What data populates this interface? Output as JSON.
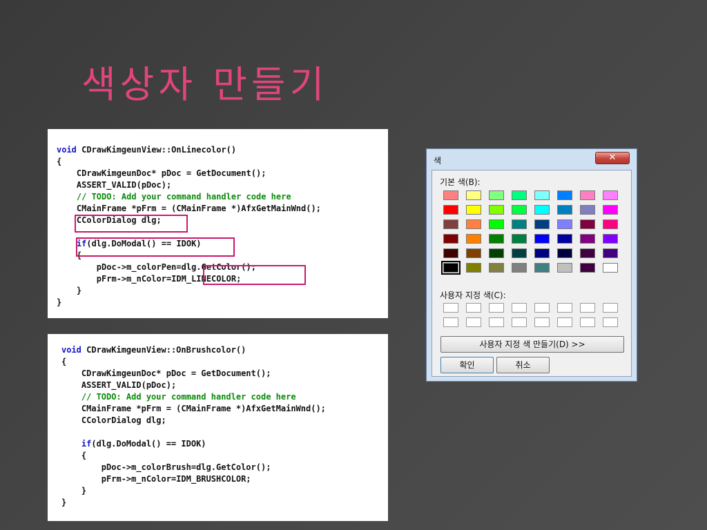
{
  "slide": {
    "title": "색상자 만들기"
  },
  "code_blocks": [
    {
      "lines": [
        [
          {
            "t": "void",
            "c": "kw"
          },
          {
            "t": " CDrawKimgeunView::OnLinecolor()"
          }
        ],
        [
          {
            "t": "{"
          }
        ],
        [
          {
            "t": "    CDrawKimgeunDoc* pDoc = GetDocument();"
          }
        ],
        [
          {
            "t": "    ASSERT_VALID(pDoc);"
          }
        ],
        [
          {
            "t": "    // TODO: Add your command handler code here",
            "c": "cm"
          }
        ],
        [
          {
            "t": "    CMainFrame *pFrm = (CMainFrame *)AfxGetMainWnd();"
          }
        ],
        [
          {
            "t": "    CColorDialog dlg;"
          }
        ],
        [
          {
            "t": ""
          }
        ],
        [
          {
            "t": "    "
          },
          {
            "t": "if",
            "c": "kw"
          },
          {
            "t": "(dlg.DoModal() == IDOK)"
          }
        ],
        [
          {
            "t": "    {"
          }
        ],
        [
          {
            "t": "        pDoc->m_colorPen=dlg.GetColor();"
          }
        ],
        [
          {
            "t": "        pFrm->m_nColor=IDM_LINECOLOR;"
          }
        ],
        [
          {
            "t": "    }"
          }
        ],
        [
          {
            "t": "}"
          }
        ]
      ]
    },
    {
      "lines": [
        [
          {
            "t": "void",
            "c": "kw"
          },
          {
            "t": " CDrawKimgeunView::OnBrushcolor()"
          }
        ],
        [
          {
            "t": "{"
          }
        ],
        [
          {
            "t": "    CDrawKimgeunDoc* pDoc = GetDocument();"
          }
        ],
        [
          {
            "t": "    ASSERT_VALID(pDoc);"
          }
        ],
        [
          {
            "t": "    // TODO: Add your command handler code here",
            "c": "cm"
          }
        ],
        [
          {
            "t": "    CMainFrame *pFrm = (CMainFrame *)AfxGetMainWnd();"
          }
        ],
        [
          {
            "t": "    CColorDialog dlg;"
          }
        ],
        [
          {
            "t": ""
          }
        ],
        [
          {
            "t": "    "
          },
          {
            "t": "if",
            "c": "kw"
          },
          {
            "t": "(dlg.DoModal() == IDOK)"
          }
        ],
        [
          {
            "t": "    {"
          }
        ],
        [
          {
            "t": "        pDoc->m_colorBrush=dlg.GetColor();"
          }
        ],
        [
          {
            "t": "        pFrm->m_nColor=IDM_BRUSHCOLOR;"
          }
        ],
        [
          {
            "t": "    }"
          }
        ],
        [
          {
            "t": "}"
          }
        ]
      ]
    }
  ],
  "color_dialog": {
    "title": "색",
    "close_icon": "close-icon",
    "basic_colors_label": "기본 색(B):",
    "custom_colors_label": "사용자 지정 색(C):",
    "define_custom_button": "사용자 지정 색 만들기(D) >>",
    "ok_button": "확인",
    "cancel_button": "취소",
    "selected_index": 40,
    "basic_colors": [
      "#ff8080",
      "#ffff80",
      "#80ff80",
      "#00ff80",
      "#80ffff",
      "#0080ff",
      "#ff80c0",
      "#ff80ff",
      "#ff0000",
      "#ffff00",
      "#80ff00",
      "#00ff40",
      "#00ffff",
      "#0080c0",
      "#8080c0",
      "#ff00ff",
      "#804040",
      "#ff8040",
      "#00ff00",
      "#008080",
      "#004080",
      "#8080ff",
      "#800040",
      "#ff0080",
      "#800000",
      "#ff8000",
      "#008000",
      "#008040",
      "#0000ff",
      "#0000a0",
      "#800080",
      "#8000ff",
      "#400000",
      "#804000",
      "#004000",
      "#004040",
      "#000080",
      "#000040",
      "#400040",
      "#400080",
      "#000000",
      "#808000",
      "#808040",
      "#808080",
      "#408080",
      "#c0c0c0",
      "#400040",
      "#ffffff"
    ],
    "custom_colors_count": 16
  }
}
